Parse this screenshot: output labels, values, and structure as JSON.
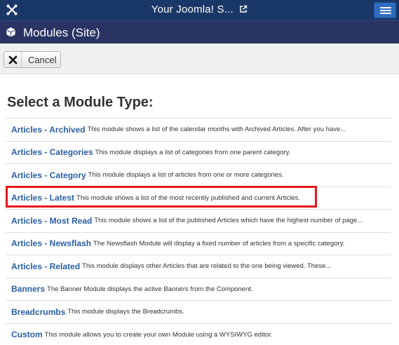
{
  "topbar": {
    "site_title": "Your Joomla! S...",
    "logo_icon": "joomla-logo-icon",
    "external_icon": "external-link-icon",
    "menu_icon": "hamburger-menu-icon"
  },
  "subheader": {
    "icon": "cube-icon",
    "title": "Modules (Site)"
  },
  "toolbar": {
    "cancel_label": "Cancel",
    "cancel_icon": "close-icon"
  },
  "main": {
    "heading": "Select a Module Type:",
    "modules": [
      {
        "name": "Articles - Archived",
        "description": "This module shows a list of the calendar months with Archived Articles. After you have..."
      },
      {
        "name": "Articles - Categories",
        "description": "This module displays a list of categories from one parent category."
      },
      {
        "name": "Articles - Category",
        "description": "This module displays a list of articles from one or more categories."
      },
      {
        "name": "Articles - Latest",
        "description": "This module shows a list of the most recently published and current Articles."
      },
      {
        "name": "Articles - Most Read",
        "description": "This module shows a list of the published Articles which have the highest number of page..."
      },
      {
        "name": "Articles - Newsflash",
        "description": "The Newsflash Module will display a fixed number of articles from a specific category."
      },
      {
        "name": "Articles - Related",
        "description": "This module displays other Articles that are related to the one being viewed. These..."
      },
      {
        "name": "Banners",
        "description": "The Banner Module displays the active Banners from the Component."
      },
      {
        "name": "Breadcrumbs",
        "description": "This module displays the Breadcrumbs."
      },
      {
        "name": "Custom",
        "description": "This module allows you to create your own Module using a WYSIWYG editor."
      }
    ]
  },
  "colors": {
    "topbar": "#1a3867",
    "subheader": "#2a3464",
    "link": "#2a5fa3",
    "highlight": "#e8161b"
  }
}
